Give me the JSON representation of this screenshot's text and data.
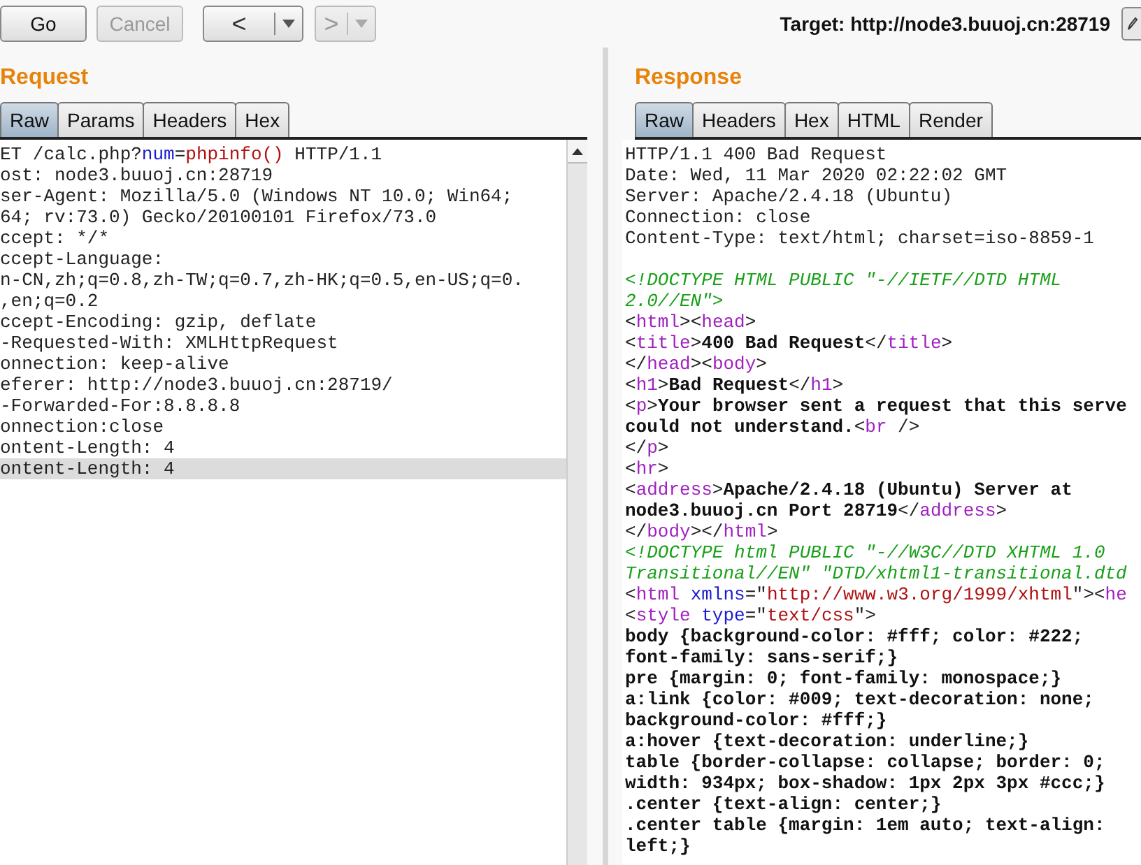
{
  "toolbar": {
    "buttons": [
      {
        "label": "Go",
        "disabled": false
      },
      {
        "label": "Cancel",
        "disabled": true
      }
    ],
    "nav": [
      {
        "kind": "back",
        "label": "<",
        "disabled": false
      },
      {
        "kind": "forward",
        "label": ">",
        "disabled": true
      }
    ],
    "target": "Target: http://node3.buuoj.cn:28719"
  },
  "request": {
    "title": "Request",
    "tabs": [
      {
        "label": "Raw",
        "selected": true
      },
      {
        "label": "Params",
        "selected": false
      },
      {
        "label": "Headers",
        "selected": false
      },
      {
        "label": "Hex",
        "selected": false
      }
    ],
    "lines": [
      {
        "current": false,
        "segments": [
          {
            "kind": "plain",
            "text": "ET /calc.php?"
          },
          {
            "kind": "param",
            "text": "num"
          },
          {
            "kind": "plain",
            "text": "="
          },
          {
            "kind": "value",
            "text": "phpinfo()"
          },
          {
            "kind": "plain",
            "text": " HTTP/1.1"
          }
        ]
      },
      {
        "current": false,
        "segments": [
          {
            "kind": "plain",
            "text": "ost: node3.buuoj.cn:28719"
          }
        ]
      },
      {
        "current": false,
        "segments": [
          {
            "kind": "plain",
            "text": "ser-Agent: Mozilla/5.0 (Windows NT 10.0; Win64;"
          }
        ]
      },
      {
        "current": false,
        "segments": [
          {
            "kind": "plain",
            "text": "64; rv:73.0) Gecko/20100101 Firefox/73.0"
          }
        ]
      },
      {
        "current": false,
        "segments": [
          {
            "kind": "plain",
            "text": "ccept: */*"
          }
        ]
      },
      {
        "current": false,
        "segments": [
          {
            "kind": "plain",
            "text": "ccept-Language:"
          }
        ]
      },
      {
        "current": false,
        "segments": [
          {
            "kind": "plain",
            "text": "n-CN,zh;q=0.8,zh-TW;q=0.7,zh-HK;q=0.5,en-US;q=0."
          }
        ]
      },
      {
        "current": false,
        "segments": [
          {
            "kind": "plain",
            "text": ",en;q=0.2"
          }
        ]
      },
      {
        "current": false,
        "segments": [
          {
            "kind": "plain",
            "text": "ccept-Encoding: gzip, deflate"
          }
        ]
      },
      {
        "current": false,
        "segments": [
          {
            "kind": "plain",
            "text": "-Requested-With: XMLHttpRequest"
          }
        ]
      },
      {
        "current": false,
        "segments": [
          {
            "kind": "plain",
            "text": "onnection: keep-alive"
          }
        ]
      },
      {
        "current": false,
        "segments": [
          {
            "kind": "plain",
            "text": "eferer: http://node3.buuoj.cn:28719/"
          }
        ]
      },
      {
        "current": false,
        "segments": [
          {
            "kind": "plain",
            "text": "-Forwarded-For:8.8.8.8"
          }
        ]
      },
      {
        "current": false,
        "segments": [
          {
            "kind": "plain",
            "text": "onnection:close"
          }
        ]
      },
      {
        "current": false,
        "segments": [
          {
            "kind": "plain",
            "text": "ontent-Length: 4"
          }
        ]
      },
      {
        "current": true,
        "segments": [
          {
            "kind": "plain",
            "text": "ontent-Length: 4"
          }
        ]
      }
    ]
  },
  "response": {
    "title": "Response",
    "tabs": [
      {
        "label": "Raw",
        "selected": true
      },
      {
        "label": "Headers",
        "selected": false
      },
      {
        "label": "Hex",
        "selected": false
      },
      {
        "label": "HTML",
        "selected": false
      },
      {
        "label": "Render",
        "selected": false
      }
    ],
    "lines": [
      [
        {
          "kind": "plain",
          "text": "HTTP/1.1 400 Bad Request"
        }
      ],
      [
        {
          "kind": "plain",
          "text": "Date: Wed, 11 Mar 2020 02:22:02 GMT"
        }
      ],
      [
        {
          "kind": "plain",
          "text": "Server: Apache/2.4.18 (Ubuntu)"
        }
      ],
      [
        {
          "kind": "plain",
          "text": "Connection: close"
        }
      ],
      [
        {
          "kind": "plain",
          "text": "Content-Type: text/html; charset=iso-8859-1"
        }
      ]
    ],
    "body": [
      [
        {
          "kind": "comment",
          "text": "<!DOCTYPE HTML PUBLIC \"-//IETF//DTD HTML"
        }
      ],
      [
        {
          "kind": "comment",
          "text": "2.0//EN\">"
        }
      ],
      [
        {
          "kind": "plain",
          "text": "<"
        },
        {
          "kind": "tag",
          "text": "html"
        },
        {
          "kind": "plain",
          "text": "><"
        },
        {
          "kind": "tag",
          "text": "head"
        },
        {
          "kind": "plain",
          "text": ">"
        }
      ],
      [
        {
          "kind": "plain",
          "text": "<"
        },
        {
          "kind": "tag",
          "text": "title"
        },
        {
          "kind": "plain",
          "text": ">"
        },
        {
          "kind": "bold",
          "text": "400 Bad Request"
        },
        {
          "kind": "plain",
          "text": "</"
        },
        {
          "kind": "tag",
          "text": "title"
        },
        {
          "kind": "plain",
          "text": ">"
        }
      ],
      [
        {
          "kind": "plain",
          "text": "</"
        },
        {
          "kind": "tag",
          "text": "head"
        },
        {
          "kind": "plain",
          "text": "><"
        },
        {
          "kind": "tag",
          "text": "body"
        },
        {
          "kind": "plain",
          "text": ">"
        }
      ],
      [
        {
          "kind": "plain",
          "text": "<"
        },
        {
          "kind": "tag",
          "text": "h1"
        },
        {
          "kind": "plain",
          "text": ">"
        },
        {
          "kind": "bold",
          "text": "Bad Request"
        },
        {
          "kind": "plain",
          "text": "</"
        },
        {
          "kind": "tag",
          "text": "h1"
        },
        {
          "kind": "plain",
          "text": ">"
        }
      ],
      [
        {
          "kind": "plain",
          "text": "<"
        },
        {
          "kind": "tag",
          "text": "p"
        },
        {
          "kind": "plain",
          "text": ">"
        },
        {
          "kind": "bold",
          "text": "Your browser sent a request that this serve"
        }
      ],
      [
        {
          "kind": "bold",
          "text": "could not understand."
        },
        {
          "kind": "plain",
          "text": "<"
        },
        {
          "kind": "tag",
          "text": "br"
        },
        {
          "kind": "plain",
          "text": " />"
        }
      ],
      [
        {
          "kind": "plain",
          "text": "</"
        },
        {
          "kind": "tag",
          "text": "p"
        },
        {
          "kind": "plain",
          "text": ">"
        }
      ],
      [
        {
          "kind": "plain",
          "text": "<"
        },
        {
          "kind": "tag",
          "text": "hr"
        },
        {
          "kind": "plain",
          "text": ">"
        }
      ],
      [
        {
          "kind": "plain",
          "text": "<"
        },
        {
          "kind": "tag",
          "text": "address"
        },
        {
          "kind": "plain",
          "text": ">"
        },
        {
          "kind": "bold",
          "text": "Apache/2.4.18 (Ubuntu) Server at"
        }
      ],
      [
        {
          "kind": "bold",
          "text": "node3.buuoj.cn Port 28719"
        },
        {
          "kind": "plain",
          "text": "</"
        },
        {
          "kind": "tag",
          "text": "address"
        },
        {
          "kind": "plain",
          "text": ">"
        }
      ],
      [
        {
          "kind": "plain",
          "text": "</"
        },
        {
          "kind": "tag",
          "text": "body"
        },
        {
          "kind": "plain",
          "text": "></"
        },
        {
          "kind": "tag",
          "text": "html"
        },
        {
          "kind": "plain",
          "text": ">"
        }
      ],
      [
        {
          "kind": "comment",
          "text": "<!DOCTYPE html PUBLIC \"-//W3C//DTD XHTML 1.0"
        }
      ],
      [
        {
          "kind": "comment",
          "text": "Transitional//EN\" \"DTD/xhtml1-transitional.dtd"
        }
      ],
      [
        {
          "kind": "plain",
          "text": "<"
        },
        {
          "kind": "tag",
          "text": "html"
        },
        {
          "kind": "attr",
          "text": " xmlns"
        },
        {
          "kind": "plain",
          "text": "=\""
        },
        {
          "kind": "value",
          "text": "http://www.w3.org/1999/xhtml"
        },
        {
          "kind": "plain",
          "text": "\"><"
        },
        {
          "kind": "tag",
          "text": "he"
        }
      ],
      [
        {
          "kind": "plain",
          "text": "<"
        },
        {
          "kind": "tag",
          "text": "style"
        },
        {
          "kind": "attr",
          "text": " type"
        },
        {
          "kind": "plain",
          "text": "=\""
        },
        {
          "kind": "value",
          "text": "text/css"
        },
        {
          "kind": "plain",
          "text": "\">"
        }
      ],
      [
        {
          "kind": "bold",
          "text": "body {background-color: #fff; color: #222;"
        }
      ],
      [
        {
          "kind": "bold",
          "text": "font-family: sans-serif;}"
        }
      ],
      [
        {
          "kind": "bold",
          "text": "pre {margin: 0; font-family: monospace;}"
        }
      ],
      [
        {
          "kind": "bold",
          "text": "a:link {color: #009; text-decoration: none;"
        }
      ],
      [
        {
          "kind": "bold",
          "text": "background-color: #fff;}"
        }
      ],
      [
        {
          "kind": "bold",
          "text": "a:hover {text-decoration: underline;}"
        }
      ],
      [
        {
          "kind": "bold",
          "text": "table {border-collapse: collapse; border: 0;"
        }
      ],
      [
        {
          "kind": "bold",
          "text": "width: 934px; box-shadow: 1px 2px 3px #ccc;}"
        }
      ],
      [
        {
          "kind": "bold",
          "text": ".center {text-align: center;}"
        }
      ],
      [
        {
          "kind": "bold",
          "text": ".center table {margin: 1em auto; text-align:"
        }
      ],
      [
        {
          "kind": "bold",
          "text": "left;}"
        }
      ]
    ]
  }
}
